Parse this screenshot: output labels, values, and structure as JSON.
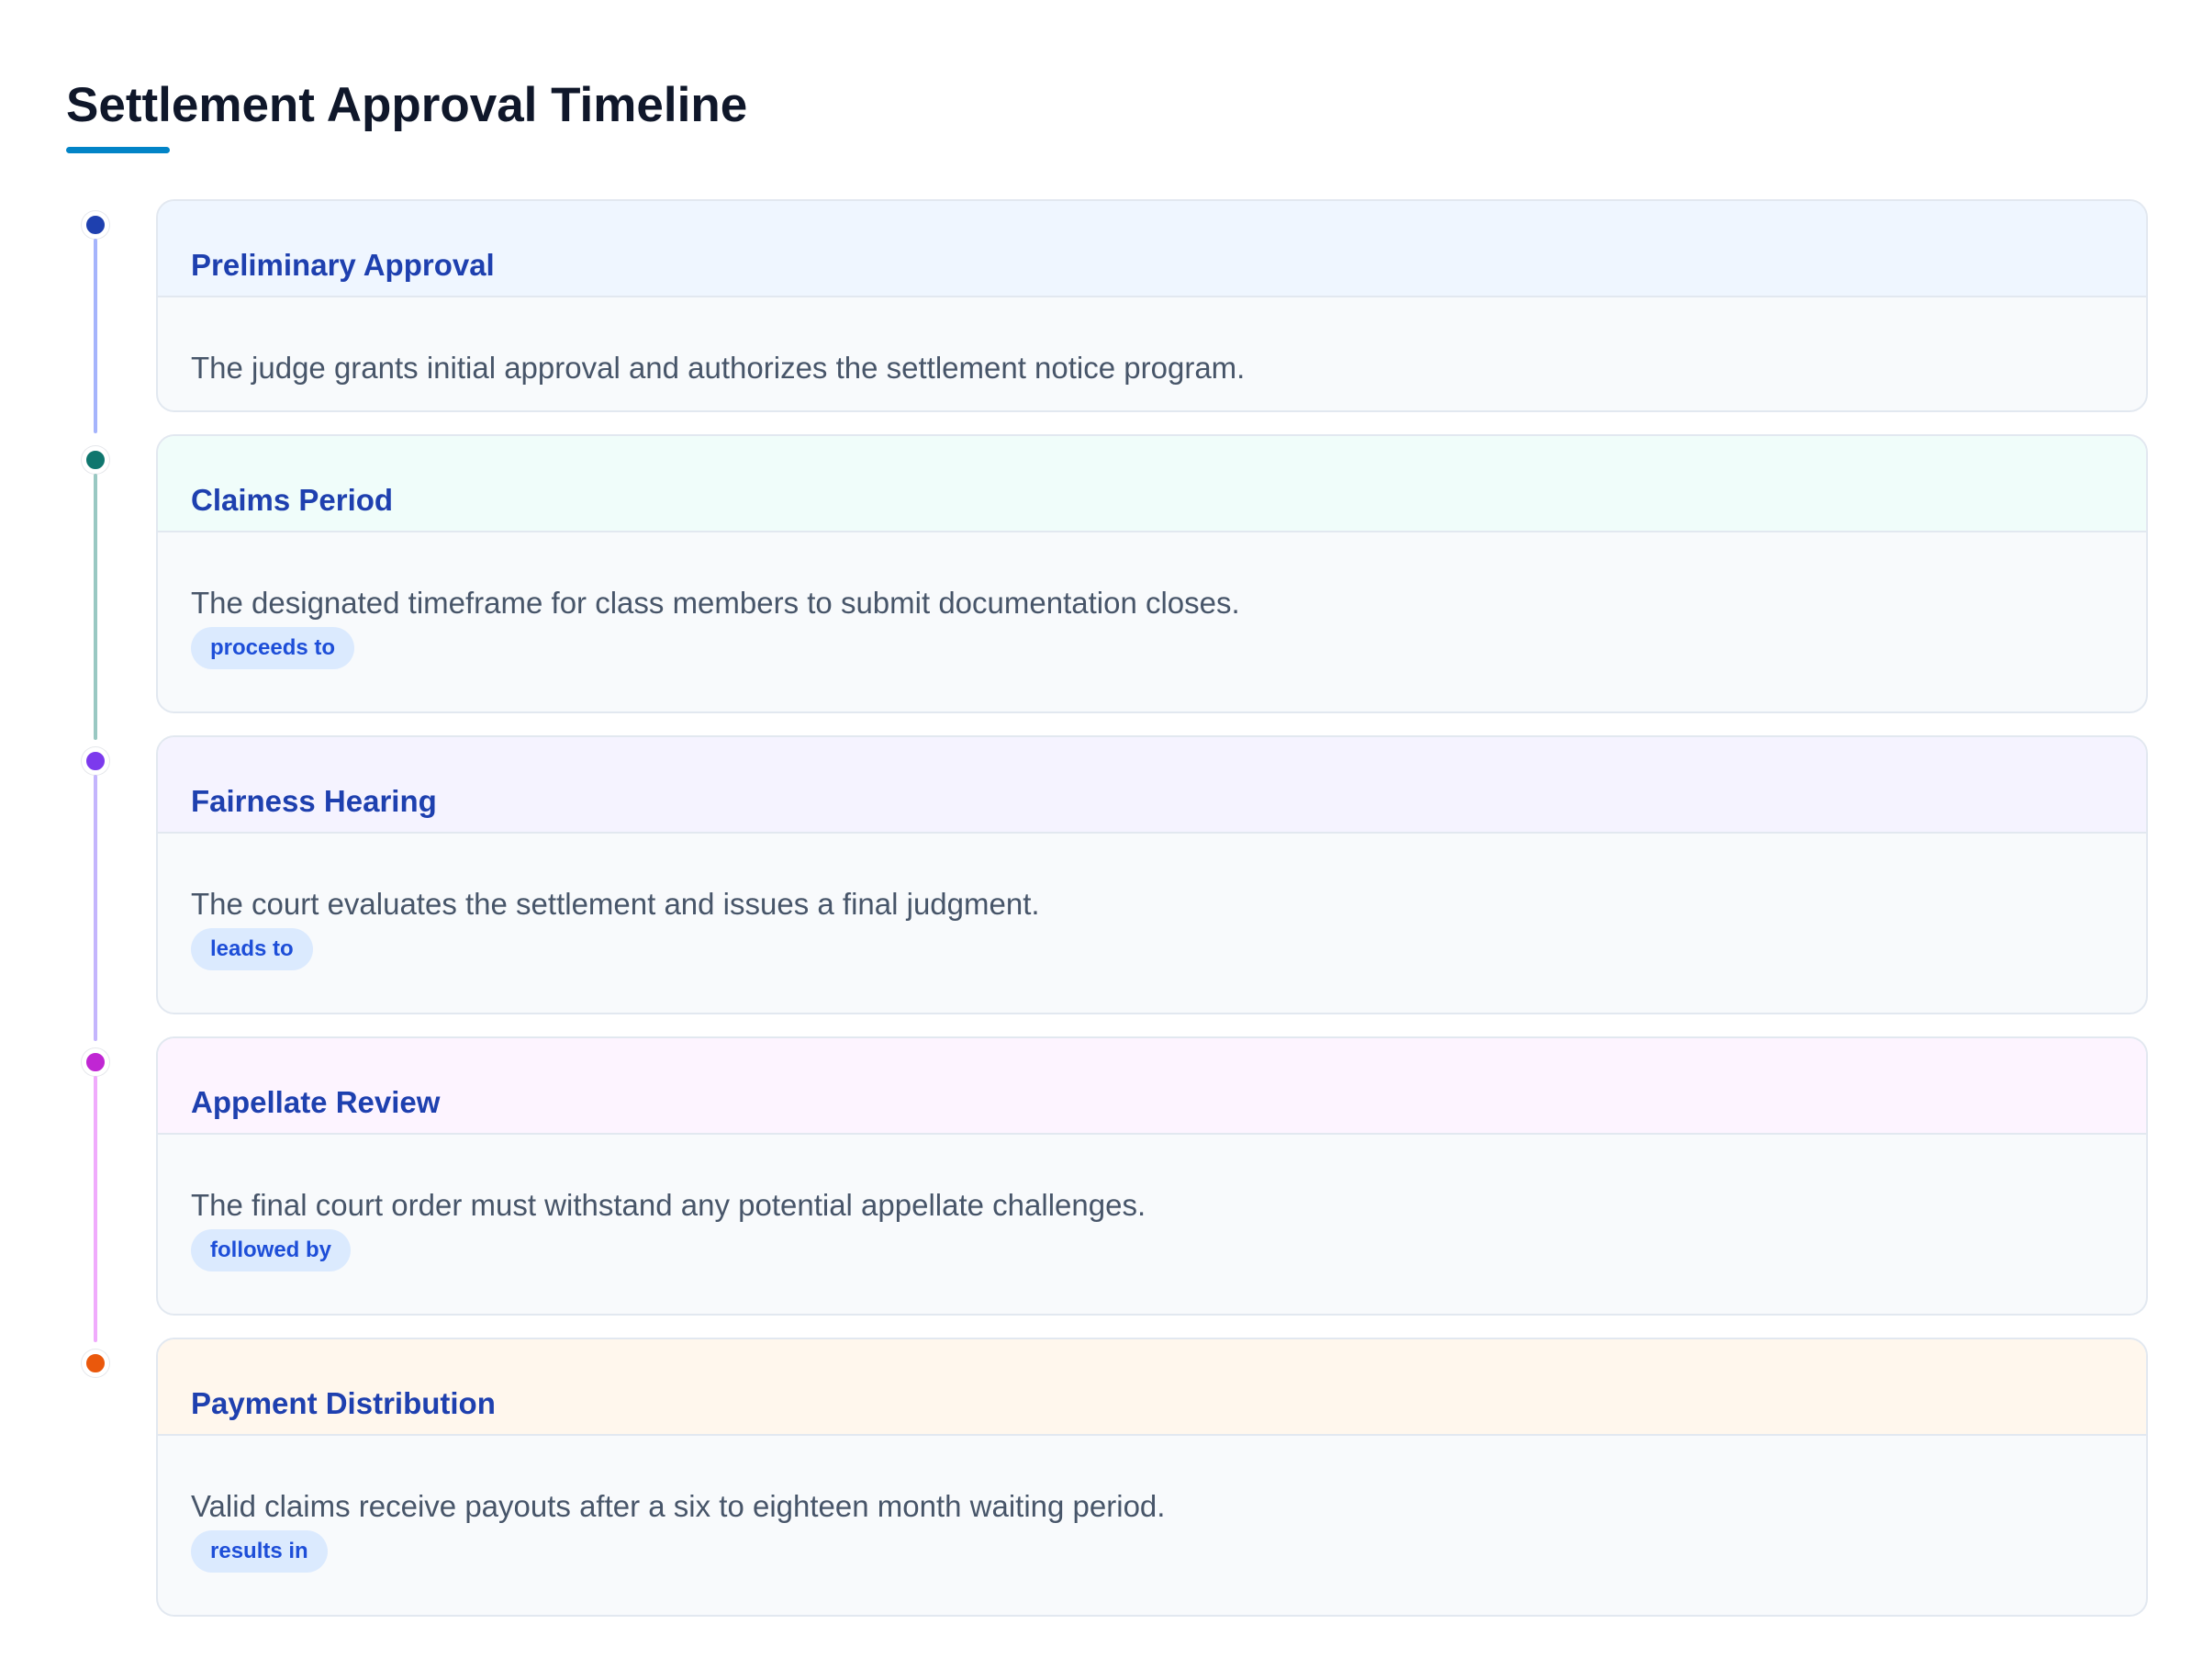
{
  "page": {
    "title": "Settlement Approval Timeline",
    "accent_color": "#0284c7"
  },
  "steps": [
    {
      "title": "Preliminary Approval",
      "description": "The judge grants initial approval and authorizes the settlement notice program.",
      "relation": "",
      "dot_color": "#1e40af",
      "line_color": "#a5b4fc",
      "header_bg": "#eff6ff"
    },
    {
      "title": "Claims Period",
      "description": "The designated timeframe for class members to submit documentation closes.",
      "relation": "proceeds to",
      "dot_color": "#0f766e",
      "line_color": "#99c8c2",
      "header_bg": "#f0fdfa"
    },
    {
      "title": "Fairness Hearing",
      "description": "The court evaluates the settlement and issues a final judgment.",
      "relation": "leads to",
      "dot_color": "#7c3aed",
      "line_color": "#c4b5fd",
      "header_bg": "#f5f3ff"
    },
    {
      "title": "Appellate Review",
      "description": "The final court order must withstand any potential appellate challenges.",
      "relation": "followed by",
      "dot_color": "#c026d3",
      "line_color": "#f0abfc",
      "header_bg": "#fdf4ff"
    },
    {
      "title": "Payment Distribution",
      "description": "Valid claims receive payouts after a six to eighteen month waiting period.",
      "relation": "results in",
      "dot_color": "#ea580c",
      "line_color": "",
      "header_bg": "#fff7ed"
    }
  ]
}
